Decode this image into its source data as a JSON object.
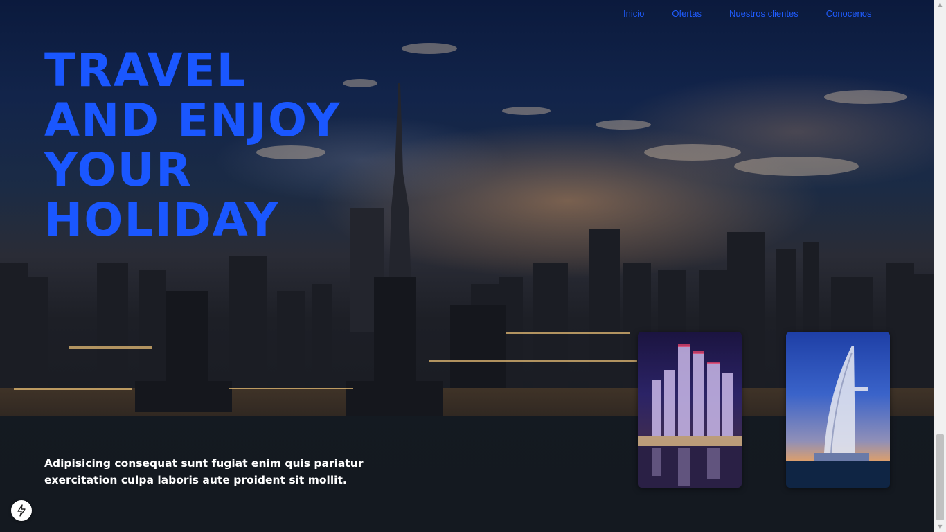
{
  "nav": {
    "items": [
      {
        "label": "Inicio"
      },
      {
        "label": "Ofertas"
      },
      {
        "label": "Nuestros clientes"
      },
      {
        "label": "Conocenos"
      }
    ]
  },
  "hero": {
    "headline_lines": [
      "TRAVEL",
      "AND ENJOY",
      "YOUR",
      "HOLIDAY"
    ],
    "tagline": "Adipisicing consequat sunt fugiat enim quis pariatur exercitation culpa laboris aute proident sit mollit."
  },
  "gallery": {
    "images": [
      {
        "subject": "dubai-marina-night-photo"
      },
      {
        "subject": "burj-al-arab-photo"
      }
    ]
  },
  "badge": {
    "icon": "lightning-bolt-icon"
  },
  "colors": {
    "accent": "#1a57ff",
    "nav_link": "#1f5cff",
    "tagline_text": "#ffffff"
  }
}
